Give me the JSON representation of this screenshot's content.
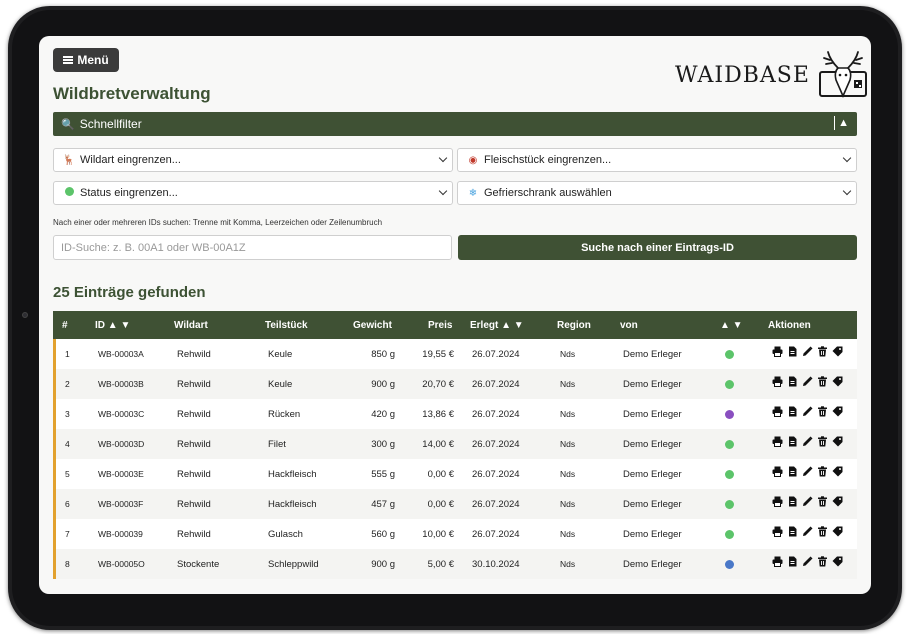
{
  "menu": {
    "label": "Menü"
  },
  "logo": {
    "text": "WAIDBASE"
  },
  "page": {
    "title": "Wildbretverwaltung"
  },
  "quickfilter": {
    "label": "Schnellfilter",
    "toggle": "▲"
  },
  "filters": {
    "wildart": "Wildart eingrenzen...",
    "fleischstueck": "Fleischstück eingrenzen...",
    "status": "Status eingrenzen...",
    "gefrierschrank": "Gefrierschrank auswählen"
  },
  "id_search": {
    "hint": "Nach einer oder mehreren IDs suchen: Trenne mit Komma, Leerzeichen oder Zeilenumbruch",
    "placeholder": "ID-Suche: z. B. 00A1 oder WB-00A1Z",
    "button": "Suche nach einer Eintrags-ID"
  },
  "results": {
    "count_label": "25 Einträge gefunden"
  },
  "table": {
    "headers": {
      "num": "#",
      "id": "ID ▲ ▼",
      "wildart": "Wildart",
      "teilstueck": "Teilstück",
      "gewicht": "Gewicht",
      "preis": "Preis",
      "erlegt": "Erlegt ▲ ▼",
      "region": "Region",
      "von": "von",
      "status": "▲ ▼",
      "aktionen": "Aktionen"
    },
    "rows": [
      {
        "num": "1",
        "id": "WB-00003A",
        "wildart": "Rehwild",
        "teilstueck": "Keule",
        "gewicht": "850 g",
        "preis": "19,55 €",
        "erlegt": "26.07.2024",
        "region": "Nds",
        "von": "Demo Erleger",
        "status_color": "#5cc46a"
      },
      {
        "num": "2",
        "id": "WB-00003B",
        "wildart": "Rehwild",
        "teilstueck": "Keule",
        "gewicht": "900 g",
        "preis": "20,70 €",
        "erlegt": "26.07.2024",
        "region": "Nds",
        "von": "Demo Erleger",
        "status_color": "#5cc46a"
      },
      {
        "num": "3",
        "id": "WB-00003C",
        "wildart": "Rehwild",
        "teilstueck": "Rücken",
        "gewicht": "420 g",
        "preis": "13,86 €",
        "erlegt": "26.07.2024",
        "region": "Nds",
        "von": "Demo Erleger",
        "status_color": "#8a4fc0"
      },
      {
        "num": "4",
        "id": "WB-00003D",
        "wildart": "Rehwild",
        "teilstueck": "Filet",
        "gewicht": "300 g",
        "preis": "14,00 €",
        "erlegt": "26.07.2024",
        "region": "Nds",
        "von": "Demo Erleger",
        "status_color": "#5cc46a"
      },
      {
        "num": "5",
        "id": "WB-00003E",
        "wildart": "Rehwild",
        "teilstueck": "Hackfleisch",
        "gewicht": "555 g",
        "preis": "0,00 €",
        "erlegt": "26.07.2024",
        "region": "Nds",
        "von": "Demo Erleger",
        "status_color": "#5cc46a"
      },
      {
        "num": "6",
        "id": "WB-00003F",
        "wildart": "Rehwild",
        "teilstueck": "Hackfleisch",
        "gewicht": "457 g",
        "preis": "0,00 €",
        "erlegt": "26.07.2024",
        "region": "Nds",
        "von": "Demo Erleger",
        "status_color": "#5cc46a"
      },
      {
        "num": "7",
        "id": "WB-000039",
        "wildart": "Rehwild",
        "teilstueck": "Gulasch",
        "gewicht": "560 g",
        "preis": "10,00 €",
        "erlegt": "26.07.2024",
        "region": "Nds",
        "von": "Demo Erleger",
        "status_color": "#5cc46a"
      },
      {
        "num": "8",
        "id": "WB-00005O",
        "wildart": "Stockente",
        "teilstueck": "Schleppwild",
        "gewicht": "900 g",
        "preis": "5,00 €",
        "erlegt": "30.10.2024",
        "region": "Nds",
        "von": "Demo Erleger",
        "status_color": "#4a78c8"
      }
    ]
  },
  "icons": [
    "print-icon",
    "document-icon",
    "pencil-icon",
    "trash-icon",
    "tag-icon"
  ]
}
